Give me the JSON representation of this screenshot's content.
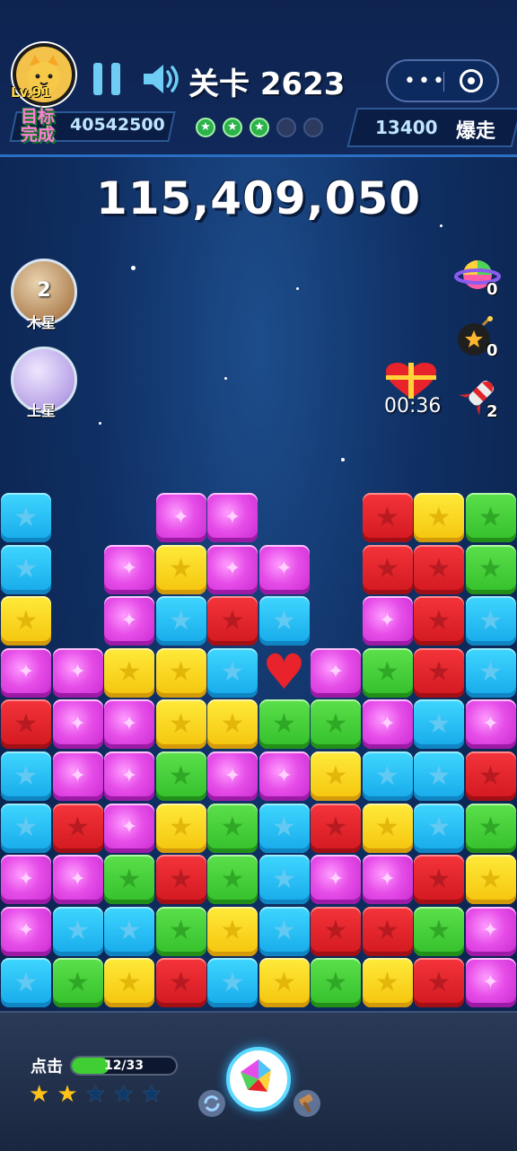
{
  "header": {
    "level_badge": "Lv.91",
    "level_title": "关卡 2623",
    "target_label": "目标\n完成",
    "target_score": "40542500",
    "stars_earned": 3,
    "stars_total": 5,
    "right_value": "13400",
    "right_label": "爆走"
  },
  "score": "115,409,050",
  "planets": [
    {
      "name": "木星",
      "count": "2"
    },
    {
      "name": "土星",
      "count": ""
    }
  ],
  "powerups": [
    {
      "icon": "rainbow-planet-icon",
      "count": "0"
    },
    {
      "icon": "bomb-icon",
      "count": "0"
    },
    {
      "icon": "rocket-icon",
      "count": "2"
    }
  ],
  "gift_timer": "00:36",
  "board": {
    "columns": 10,
    "rows": 10,
    "cells": [
      [
        "blue",
        null,
        null,
        "magenta",
        "magenta",
        null,
        null,
        "red",
        "yellow",
        "green"
      ],
      [
        "blue",
        null,
        "magenta",
        "yellow",
        "magenta",
        "magenta",
        null,
        "red",
        "red",
        "green"
      ],
      [
        "yellow",
        null,
        "magenta",
        "blue",
        "red",
        "blue",
        null,
        "magenta",
        "red",
        "blue"
      ],
      [
        "magenta",
        "magenta",
        "yellow",
        "yellow",
        "blue",
        "heart",
        "magenta",
        "green",
        "red",
        "blue"
      ],
      [
        "red",
        "magenta",
        "magenta",
        "yellow",
        "yellow",
        "green",
        "green",
        "magenta",
        "blue",
        "magenta"
      ],
      [
        "blue",
        "magenta",
        "magenta",
        "green",
        "magenta",
        "magenta",
        "yellow",
        "blue",
        "blue",
        "red"
      ],
      [
        "blue",
        "red",
        "magenta",
        "yellow",
        "green",
        "blue",
        "red",
        "yellow",
        "blue",
        "green"
      ],
      [
        "magenta",
        "magenta",
        "green",
        "red",
        "green",
        "blue",
        "magenta",
        "magenta",
        "red",
        "yellow"
      ],
      [
        "magenta",
        "blue",
        "blue",
        "green",
        "yellow",
        "blue",
        "red",
        "red",
        "green",
        "magenta"
      ],
      [
        "blue",
        "green",
        "yellow",
        "red",
        "blue",
        "yellow",
        "green",
        "yellow",
        "red",
        "magenta"
      ]
    ]
  },
  "footer": {
    "click_label": "点击",
    "progress_text": "12/33",
    "progress_fraction": 0.3636,
    "rating_on": 2,
    "rating_total": 5
  }
}
